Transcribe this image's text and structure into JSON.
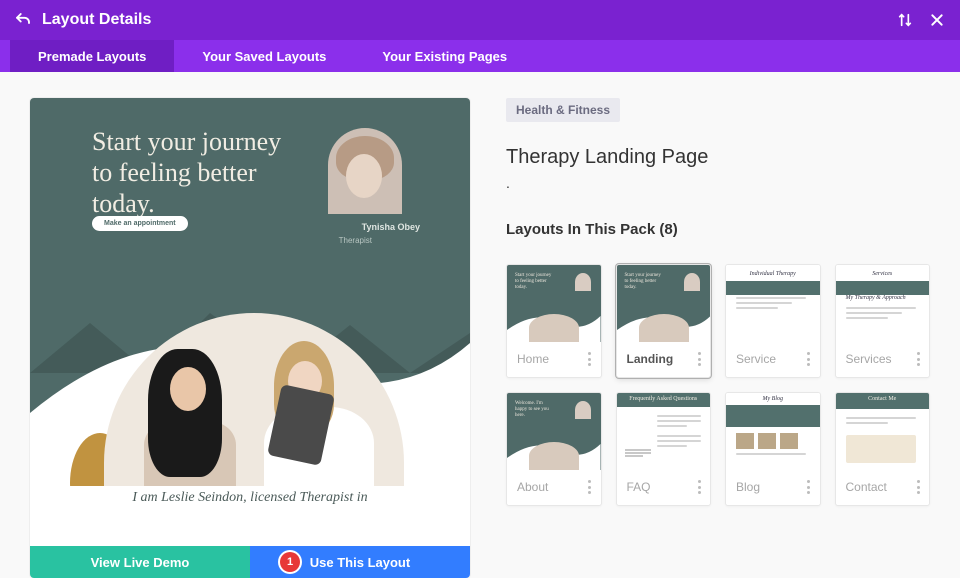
{
  "header": {
    "title": "Layout Details"
  },
  "tabs": {
    "premade": "Premade Layouts",
    "saved": "Your Saved Layouts",
    "existing": "Your Existing Pages"
  },
  "preview": {
    "headline": "Start your journey to feeling better today.",
    "cta": "Make an appointment",
    "person_name": "Tynisha Obey",
    "person_role": "Therapist",
    "subtitle": "I am Leslie Seindon, licensed Therapist in"
  },
  "actions": {
    "demo": "View Live Demo",
    "use": "Use This Layout",
    "badge": "1"
  },
  "details": {
    "category": "Health & Fitness",
    "title": "Therapy Landing Page",
    "dot": ".",
    "pack_label": "Layouts In This Pack (8)"
  },
  "cards": [
    {
      "label": "Home",
      "type": "teal-hero"
    },
    {
      "label": "Landing",
      "type": "teal-hero",
      "active": true
    },
    {
      "label": "Service",
      "type": "white-text",
      "heading": "Individual Therapy"
    },
    {
      "label": "Services",
      "type": "white-text",
      "heading": "Services",
      "sub": "My Therapy & Approach"
    },
    {
      "label": "About",
      "type": "teal-hero",
      "welcome": "Welcome. I'm happy to see you here."
    },
    {
      "label": "FAQ",
      "type": "white-faq",
      "heading": "Frequently Asked Questions"
    },
    {
      "label": "Blog",
      "type": "white-blog",
      "heading": "My Blog"
    },
    {
      "label": "Contact",
      "type": "white-contact",
      "heading": "Contact Me"
    }
  ]
}
